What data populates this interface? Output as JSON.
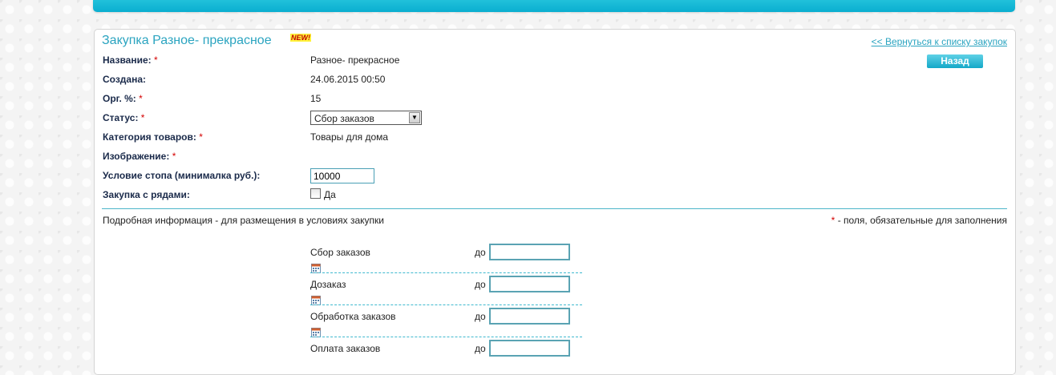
{
  "header": {
    "title": "Закупка Разное- прекрасное",
    "new_badge": "NEW!",
    "back_link": "<< Вернуться к списку закупок",
    "back_button": "Назад"
  },
  "fields": {
    "name": {
      "label": "Название:",
      "value": "Разное- прекрасное"
    },
    "created": {
      "label": "Создана:",
      "value": "24.06.2015 00:50"
    },
    "org": {
      "label": "Орг. %:",
      "value": "15"
    },
    "status": {
      "label": "Статус:",
      "selected": "Сбор заказов"
    },
    "category": {
      "label": "Категория товаров:",
      "value": "Товары для дома"
    },
    "image": {
      "label": "Изображение:"
    },
    "stop": {
      "label": "Условие стопа (минималка руб.):",
      "value": "10000"
    },
    "rows": {
      "label": "Закупка с рядами:",
      "checkbox_label": "Да",
      "checked": false
    }
  },
  "required_mark": "*",
  "details": {
    "text": "Подробная информация - для размещения в условиях закупки",
    "required_note": "- поля, обязательные для заполнения"
  },
  "stages": [
    {
      "label": "Сбор заказов",
      "until": "до",
      "value": ""
    },
    {
      "label": "Дозаказ",
      "until": "до",
      "value": ""
    },
    {
      "label": "Обработка заказов",
      "until": "до",
      "value": ""
    },
    {
      "label": "Оплата заказов",
      "until": "до",
      "value": ""
    }
  ],
  "colors": {
    "accent": "#2ba4c0",
    "topbar": "#0aaed0",
    "required": "#d40000"
  }
}
